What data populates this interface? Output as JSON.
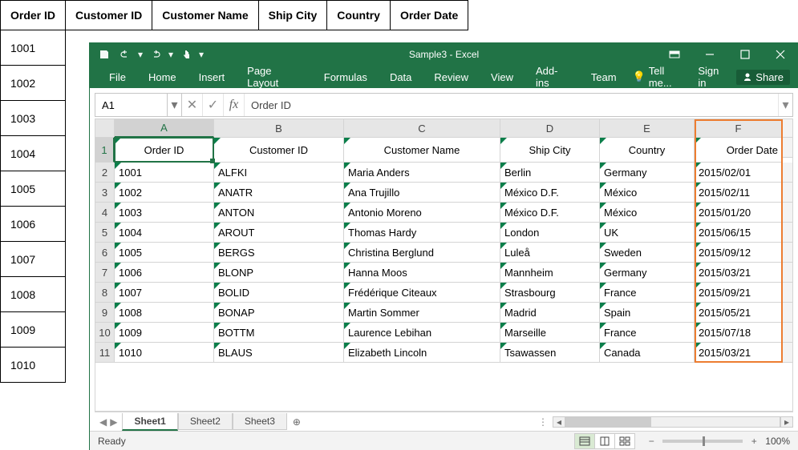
{
  "bg_table": {
    "headers": [
      "Order ID",
      "Customer ID",
      "Customer Name",
      "Ship City",
      "Country",
      "Order Date"
    ],
    "rows": [
      "1001",
      "1002",
      "1003",
      "1004",
      "1005",
      "1006",
      "1007",
      "1008",
      "1009",
      "1010"
    ]
  },
  "excel": {
    "title": "Sample3 - Excel",
    "ribbon_tabs": [
      "File",
      "Home",
      "Insert",
      "Page Layout",
      "Formulas",
      "Data",
      "Review",
      "View",
      "Add-ins",
      "Team"
    ],
    "tell_me": "Tell me...",
    "sign_in": "Sign in",
    "share": "Share",
    "name_box": "A1",
    "formula": "Order ID",
    "col_letters": [
      "A",
      "B",
      "C",
      "D",
      "E",
      "F"
    ],
    "row_numbers": [
      "1",
      "2",
      "3",
      "4",
      "5",
      "6",
      "7",
      "8",
      "9",
      "10",
      "11"
    ],
    "headers": [
      "Order ID",
      "Customer ID",
      "Customer Name",
      "Ship City",
      "Country",
      "Order Date"
    ],
    "data": [
      [
        "1001",
        "ALFKI",
        "Maria Anders",
        "Berlin",
        "Germany",
        "2015/02/01"
      ],
      [
        "1002",
        "ANATR",
        "Ana Trujillo",
        "México D.F.",
        "México",
        "2015/02/11"
      ],
      [
        "1003",
        "ANTON",
        "Antonio Moreno",
        "México D.F.",
        "México",
        "2015/01/20"
      ],
      [
        "1004",
        "AROUT",
        "Thomas Hardy",
        "London",
        "UK",
        "2015/06/15"
      ],
      [
        "1005",
        "BERGS",
        "Christina Berglund",
        "Luleå",
        "Sweden",
        "2015/09/12"
      ],
      [
        "1006",
        "BLONP",
        "Hanna Moos",
        "Mannheim",
        "Germany",
        "2015/03/21"
      ],
      [
        "1007",
        "BOLID",
        "Frédérique Citeaux",
        "Strasbourg",
        "France",
        "2015/09/21"
      ],
      [
        "1008",
        "BONAP",
        "Martin Sommer",
        "Madrid",
        "Spain",
        "2015/05/21"
      ],
      [
        "1009",
        "BOTTM",
        "Laurence Lebihan",
        "Marseille",
        "France",
        "2015/07/18"
      ],
      [
        "1010",
        "BLAUS",
        "Elizabeth Lincoln",
        "Tsawassen",
        "Canada",
        "2015/03/21"
      ]
    ],
    "sheets": [
      "Sheet1",
      "Sheet2",
      "Sheet3"
    ],
    "status": "Ready",
    "zoom": "100%"
  }
}
